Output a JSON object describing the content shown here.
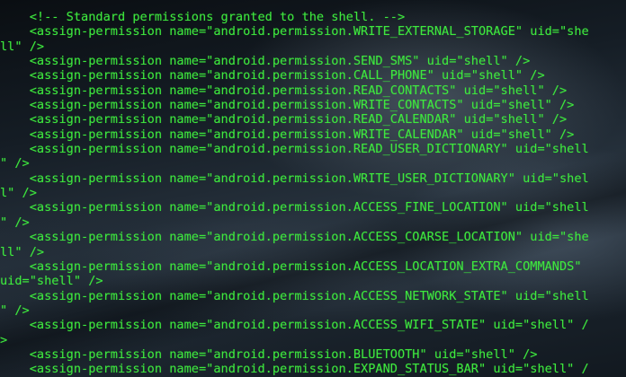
{
  "terminal": {
    "text_color": "#3ee83e",
    "lines": [
      "    <!-- Standard permissions granted to the shell. -->",
      "    <assign-permission name=\"android.permission.WRITE_EXTERNAL_STORAGE\" uid=\"she",
      "ll\" />",
      "    <assign-permission name=\"android.permission.SEND_SMS\" uid=\"shell\" />",
      "    <assign-permission name=\"android.permission.CALL_PHONE\" uid=\"shell\" />",
      "    <assign-permission name=\"android.permission.READ_CONTACTS\" uid=\"shell\" />",
      "    <assign-permission name=\"android.permission.WRITE_CONTACTS\" uid=\"shell\" />",
      "    <assign-permission name=\"android.permission.READ_CALENDAR\" uid=\"shell\" />",
      "    <assign-permission name=\"android.permission.WRITE_CALENDAR\" uid=\"shell\" />",
      "    <assign-permission name=\"android.permission.READ_USER_DICTIONARY\" uid=\"shell",
      "\" />",
      "    <assign-permission name=\"android.permission.WRITE_USER_DICTIONARY\" uid=\"shel",
      "l\" />",
      "    <assign-permission name=\"android.permission.ACCESS_FINE_LOCATION\" uid=\"shell",
      "\" />",
      "    <assign-permission name=\"android.permission.ACCESS_COARSE_LOCATION\" uid=\"she",
      "ll\" />",
      "    <assign-permission name=\"android.permission.ACCESS_LOCATION_EXTRA_COMMANDS\"",
      "uid=\"shell\" />",
      "    <assign-permission name=\"android.permission.ACCESS_NETWORK_STATE\" uid=\"shell",
      "\" />",
      "    <assign-permission name=\"android.permission.ACCESS_WIFI_STATE\" uid=\"shell\" /",
      ">",
      "    <assign-permission name=\"android.permission.BLUETOOTH\" uid=\"shell\" />",
      "    <assign-permission name=\"android.permission.EXPAND_STATUS_BAR\" uid=\"shell\" /"
    ]
  }
}
